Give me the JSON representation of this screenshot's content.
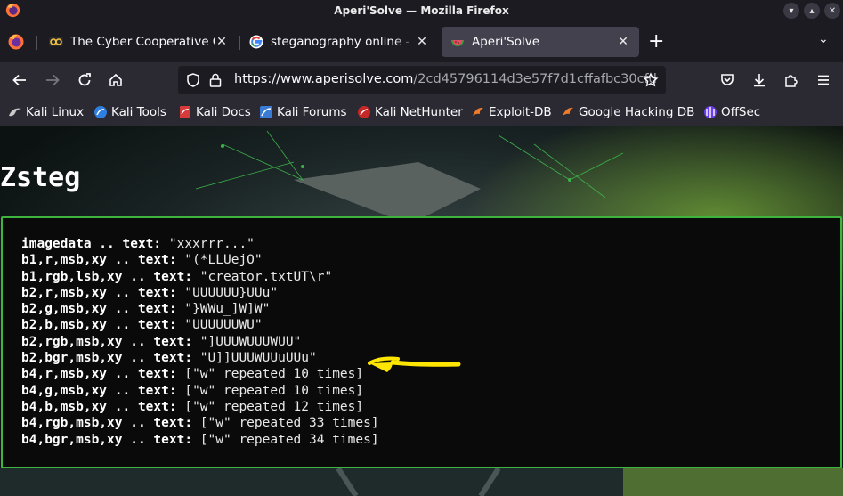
{
  "window": {
    "title": "Aperi'Solve — Mozilla Firefox"
  },
  "tabs": [
    {
      "label": "The Cyber Cooperative CTF",
      "active": false
    },
    {
      "label": "steganography online - Google Search",
      "active": false
    },
    {
      "label": "Aperi'Solve",
      "active": true
    }
  ],
  "url": {
    "host": "https://www.aperisolve.com",
    "path": "/2cd45796114d3e57f7d1cffafbc30cfd"
  },
  "bookmarks": [
    {
      "label": "Kali Linux",
      "icon": "kali-icon"
    },
    {
      "label": "Kali Tools",
      "icon": "kali-tools-icon"
    },
    {
      "label": "Kali Docs",
      "icon": "kali-docs-icon"
    },
    {
      "label": "Kali Forums",
      "icon": "kali-forums-icon"
    },
    {
      "label": "Kali NetHunter",
      "icon": "nethunter-icon"
    },
    {
      "label": "Exploit-DB",
      "icon": "exploit-db-icon"
    },
    {
      "label": "Google Hacking DB",
      "icon": "ghdb-icon"
    },
    {
      "label": "OffSec",
      "icon": "offsec-icon"
    }
  ],
  "page": {
    "title": "Zsteg",
    "lines": [
      {
        "key": "imagedata .. text:",
        "value": " \"xxxrrr...\""
      },
      {
        "key": "b1,r,msb,xy .. text:",
        "value": " \"(*LLUejO\""
      },
      {
        "key": "b1,rgb,lsb,xy .. text:",
        "value": " \"creator.txtUT\\r\""
      },
      {
        "key": "b2,r,msb,xy .. text:",
        "value": " \"UUUUUU}UUu\""
      },
      {
        "key": "b2,g,msb,xy .. text:",
        "value": " \"}WWu_]W]W\""
      },
      {
        "key": "b2,b,msb,xy .. text:",
        "value": " \"UUUUUUWU\""
      },
      {
        "key": "b2,rgb,msb,xy .. text:",
        "value": " \"]UUUWUUUWUU\""
      },
      {
        "key": "b2,bgr,msb,xy .. text:",
        "value": " \"U]]UUUWUUuUUu\""
      },
      {
        "key": "b4,r,msb,xy .. text:",
        "value": " [\"w\" repeated 10 times]"
      },
      {
        "key": "b4,g,msb,xy .. text:",
        "value": " [\"w\" repeated 10 times]"
      },
      {
        "key": "b4,b,msb,xy .. text:",
        "value": " [\"w\" repeated 12 times]"
      },
      {
        "key": "b4,rgb,msb,xy .. text:",
        "value": " [\"w\" repeated 33 times]"
      },
      {
        "key": "b4,bgr,msb,xy .. text:",
        "value": " [\"w\" repeated 34 times]"
      }
    ]
  },
  "colors": {
    "panel_border": "#3fb43f",
    "annotation_arrow": "#ffe600"
  }
}
